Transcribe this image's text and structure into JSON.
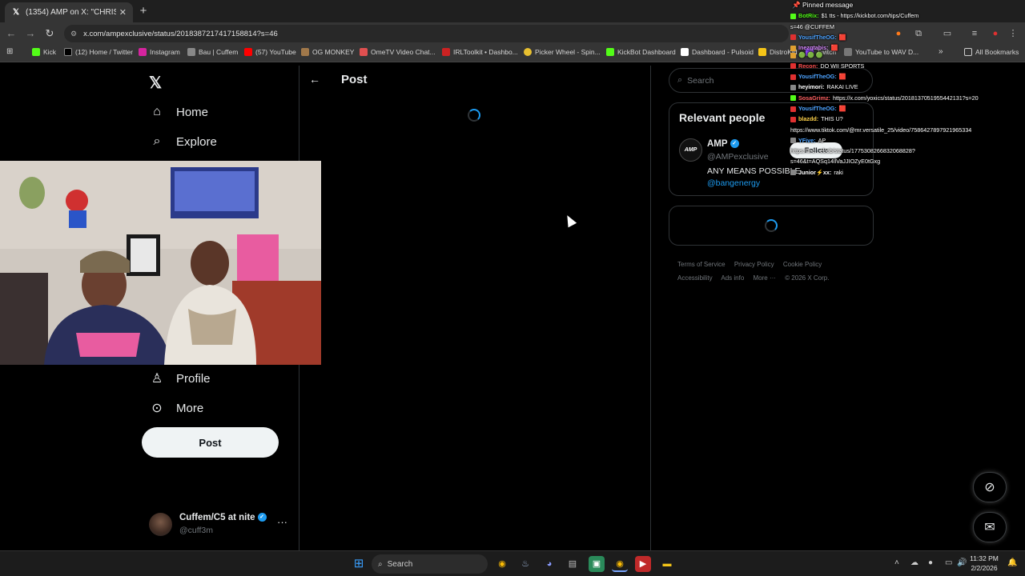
{
  "browser": {
    "tab_title": "(1354) AMP on X: \"CHRIS JUST",
    "tab_close": "✕",
    "new_tab": "+",
    "url": "x.com/ampexclusive/status/2018387217417158814?s=46",
    "bookmarks": [
      {
        "label": "Kick",
        "color": "#53fc18"
      },
      {
        "label": "(12) Home / Twitter",
        "color": "#000000"
      },
      {
        "label": "Instagram",
        "color": "#d6249f"
      },
      {
        "label": "Bau | Cuffem",
        "color": "#888888"
      },
      {
        "label": "(57) YouTube",
        "color": "#ff0000"
      },
      {
        "label": "OG MONKEY",
        "color": "#a0784a"
      },
      {
        "label": "OmeTV Video Chat...",
        "color": "#e05050"
      },
      {
        "label": "IRLToolkit • Dashbo...",
        "color": "#cc2222"
      },
      {
        "label": "Picker Wheel - Spin...",
        "color": "#e8c030"
      },
      {
        "label": "KickBot Dashboard",
        "color": "#53fc18"
      },
      {
        "label": "Dashboard - Pulsoid",
        "color": "#ffffff"
      },
      {
        "label": "DistroKid",
        "color": "#f5c518"
      },
      {
        "label": "Twitch",
        "color": "#9146ff"
      },
      {
        "label": "YouTube to WAV D...",
        "color": "#777777"
      }
    ],
    "all_bookmarks": "All Bookmarks"
  },
  "x": {
    "nav": [
      {
        "label": "Home",
        "icon": "home-icon"
      },
      {
        "label": "Explore",
        "icon": "search-icon"
      },
      {
        "label": "Profile",
        "icon": "person-icon"
      },
      {
        "label": "More",
        "icon": "more-circle-icon"
      }
    ],
    "post_button": "Post",
    "account": {
      "name": "Cuffem/C5 at nite",
      "handle": "@cuff3m"
    },
    "header_title": "Post",
    "search_placeholder": "Search",
    "relevant_people": {
      "title": "Relevant people",
      "name": "AMP",
      "handle": "@AMPexclusive",
      "bio": "ANY MEANS POSSIBLE",
      "link": "@bangenergy",
      "follow": "Follow",
      "avatar_text": "AMP"
    },
    "footer": [
      "Terms of Service",
      "Privacy Policy",
      "Cookie Policy",
      "Accessibility",
      "Ads info",
      "More ···",
      "© 2026 X Corp."
    ]
  },
  "chat": {
    "pinned": "Pinned message",
    "lines": [
      {
        "user": "BotRix:",
        "color": "#53fc18",
        "badge": "#53fc18",
        "msg": "$1 tts - https://kickbot.com/tips/Cuffem"
      },
      {
        "user": "",
        "color": "#ffffff",
        "badge": "",
        "msg": "s=46 @CUFFEM"
      },
      {
        "user": "YousifTheOG:",
        "color": "#4da3ff",
        "badge": "#e03030",
        "msg": "🟥"
      },
      {
        "user": "Inezgtabis:",
        "color": "#d98cff",
        "badge": "#e0a030",
        "msg": "🟥"
      },
      {
        "user": "",
        "color": "#ffffff",
        "badge": "#e0a030",
        "msg": "🟢 🟢 🟢"
      },
      {
        "user": "Recon:",
        "color": "#ff5050",
        "badge": "#e03030",
        "msg": "DO WII SPORTS"
      },
      {
        "user": "YousifTheOG:",
        "color": "#4da3ff",
        "badge": "#e03030",
        "msg": "🟥"
      },
      {
        "user": "heyimori:",
        "color": "#ffffff",
        "badge": "#888888",
        "msg": "RAKAI LIVE"
      },
      {
        "user": "SosaGrimz:",
        "color": "#ff6060",
        "badge": "#53fc18",
        "msg": "https://x.com/yoxics/status/2018137051955442131?s=20"
      },
      {
        "user": "YousifTheOG:",
        "color": "#4da3ff",
        "badge": "#e03030",
        "msg": "🟥"
      },
      {
        "user": "blazdd:",
        "color": "#ffd24a",
        "badge": "#e03030",
        "msg": "THIS U?"
      },
      {
        "user": "",
        "color": "#ffffff",
        "badge": "",
        "msg": "https://www.tiktok.com/@mr.versatile_25/video/7586427897921965334"
      },
      {
        "user": "YFive:",
        "color": "#4da3ff",
        "badge": "#888888",
        "msg": "AP"
      },
      {
        "user": "",
        "color": "#ffffff",
        "badge": "",
        "msg": "https://x.c...ebob/status/1775308266832068828?"
      },
      {
        "user": "",
        "color": "#ffffff",
        "badge": "",
        "msg": "s=46&t=AQSq14llVaJJIOZyE0tGxg"
      },
      {
        "user": "Junior⚡xx:",
        "color": "#ffffff",
        "badge": "#888888",
        "msg": "raki"
      }
    ]
  },
  "taskbar": {
    "search": "Search",
    "time": "11:32 PM",
    "date": "2/2/2026"
  }
}
